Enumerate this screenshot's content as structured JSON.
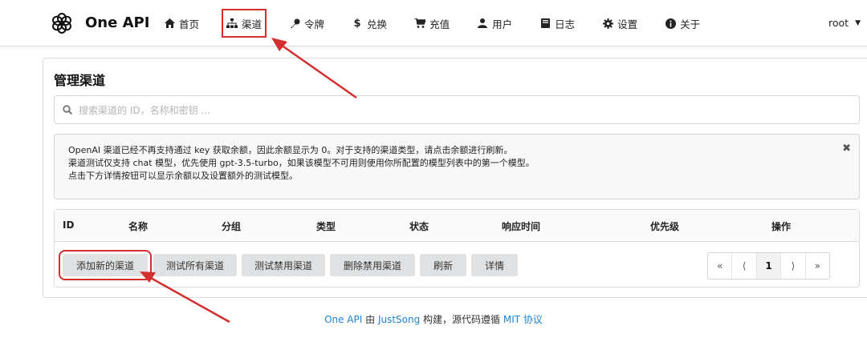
{
  "app": {
    "brand": "One API",
    "nav": [
      {
        "label": "首页",
        "icon": "home-icon"
      },
      {
        "label": "渠道",
        "icon": "sitemap-icon"
      },
      {
        "label": "令牌",
        "icon": "key-icon"
      },
      {
        "label": "兑换",
        "icon": "dollar-icon"
      },
      {
        "label": "充值",
        "icon": "cart-icon"
      },
      {
        "label": "用户",
        "icon": "user-icon"
      },
      {
        "label": "日志",
        "icon": "book-icon"
      },
      {
        "label": "设置",
        "icon": "gear-icon"
      },
      {
        "label": "关于",
        "icon": "info-icon"
      }
    ],
    "user": "root"
  },
  "page": {
    "title": "管理渠道",
    "search_placeholder": "搜索渠道的 ID，名称和密钥 ...",
    "message_lines": [
      "OpenAI 渠道已经不再支持通过 key 获取余额，因此余额显示为 0。对于支持的渠道类型，请点击余额进行刷新。",
      "渠道测试仅支持 chat 模型，优先使用 gpt-3.5-turbo，如果该模型不可用则使用你所配置的模型列表中的第一个模型。",
      "点击下方详情按钮可以显示余额以及设置额外的测试模型。"
    ],
    "table_headers": [
      "ID",
      "名称",
      "分组",
      "类型",
      "状态",
      "响应时间",
      "优先级",
      "操作"
    ],
    "buttons": [
      "添加新的渠道",
      "测试所有渠道",
      "测试禁用渠道",
      "删除禁用渠道",
      "刷新",
      "详情"
    ],
    "pagination": [
      "«",
      "⟨",
      "1",
      "⟩",
      "»"
    ]
  },
  "footer": {
    "link1": "One API",
    "text1": " 由 ",
    "link2": "JustSong",
    "text2": " 构建，源代码遵循 ",
    "link3": "MIT 协议"
  },
  "colors": {
    "annotation": "#d32f2f",
    "link": "#2185d0",
    "button_bg": "#e0e1e2"
  }
}
